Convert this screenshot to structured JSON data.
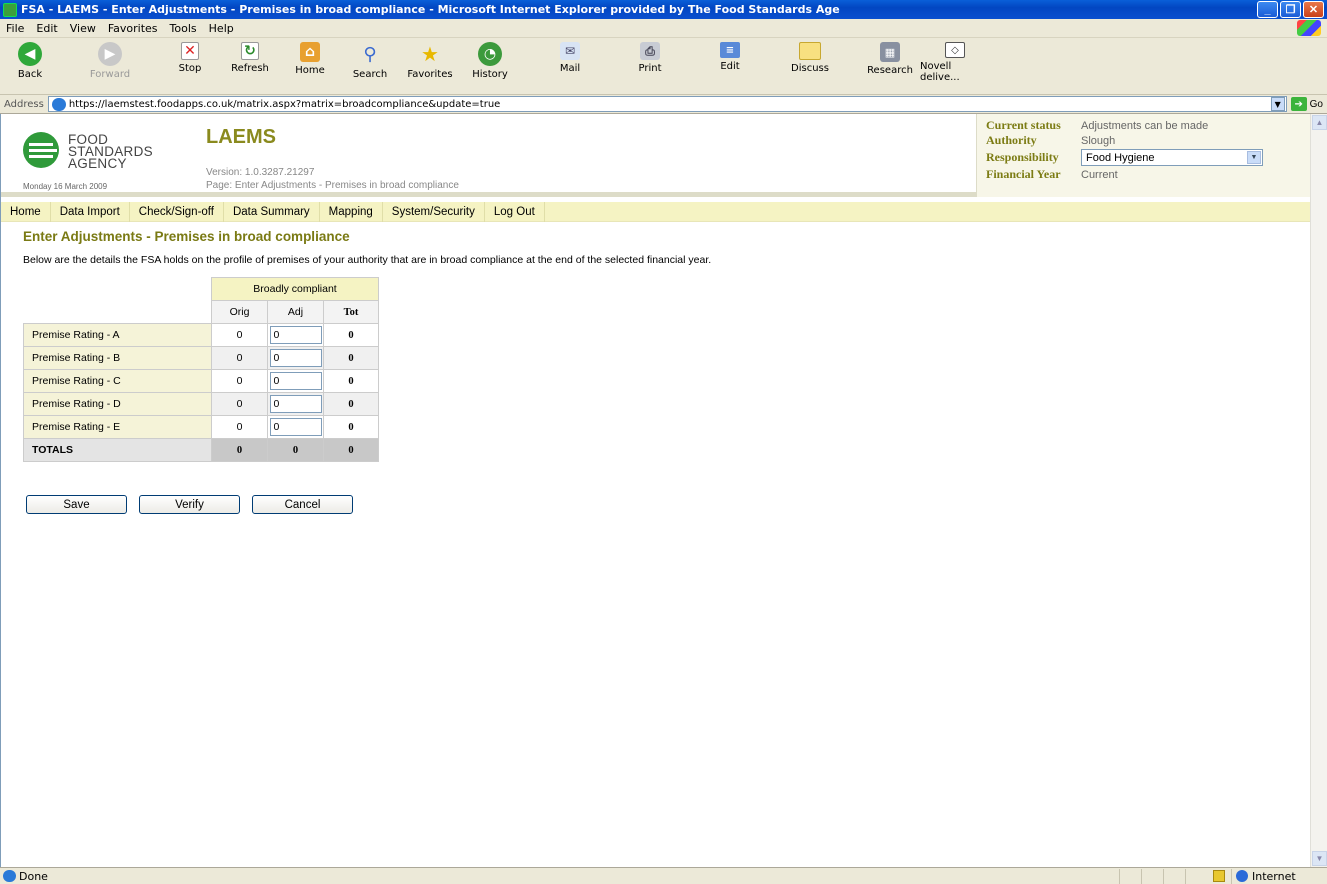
{
  "window": {
    "title": "FSA - LAEMS - Enter Adjustments - Premises in broad compliance - Microsoft Internet Explorer provided by The Food Standards Age"
  },
  "menu": [
    "File",
    "Edit",
    "View",
    "Favorites",
    "Tools",
    "Help"
  ],
  "toolbar": {
    "back": "Back",
    "forward": "Forward",
    "stop": "Stop",
    "refresh": "Refresh",
    "home": "Home",
    "search": "Search",
    "favorites": "Favorites",
    "history": "History",
    "mail": "Mail",
    "print": "Print",
    "edit": "Edit",
    "discuss": "Discuss",
    "research": "Research",
    "novell": "Novell delive..."
  },
  "address": {
    "label": "Address",
    "url": "https://laemstest.foodapps.co.uk/matrix.aspx?matrix=broadcompliance&update=true",
    "go": "Go"
  },
  "header": {
    "logo_lines": [
      "FOOD",
      "STANDARDS",
      "AGENCY"
    ],
    "date": "Monday 16 March 2009",
    "app_title": "LAEMS",
    "version": "Version: 1.0.3287.21297",
    "page": "Page: Enter Adjustments - Premises in broad compliance"
  },
  "status": {
    "current_status_label": "Current status",
    "current_status_value": "Adjustments can be made",
    "authority_label": "Authority",
    "authority_value": "Slough",
    "responsibility_label": "Responsibility",
    "responsibility_value": "Food Hygiene",
    "financial_year_label": "Financial Year",
    "financial_year_value": "Current"
  },
  "nav": [
    "Home",
    "Data Import",
    "Check/Sign-off",
    "Data Summary",
    "Mapping",
    "System/Security",
    "Log Out"
  ],
  "main": {
    "title": "Enter Adjustments - Premises in broad compliance",
    "description": "Below are the details the FSA holds on the profile of premises of your authority that are in broad compliance at the end of the selected financial year.",
    "group_header": "Broadly compliant",
    "columns": [
      "Orig",
      "Adj",
      "Tot"
    ],
    "rows": [
      {
        "label": "Premise Rating - A",
        "orig": "0",
        "adj": "0",
        "tot": "0"
      },
      {
        "label": "Premise Rating - B",
        "orig": "0",
        "adj": "0",
        "tot": "0"
      },
      {
        "label": "Premise Rating - C",
        "orig": "0",
        "adj": "0",
        "tot": "0"
      },
      {
        "label": "Premise Rating - D",
        "orig": "0",
        "adj": "0",
        "tot": "0"
      },
      {
        "label": "Premise Rating - E",
        "orig": "0",
        "adj": "0",
        "tot": "0"
      }
    ],
    "totals": {
      "label": "TOTALS",
      "orig": "0",
      "adj": "0",
      "tot": "0"
    },
    "buttons": {
      "save": "Save",
      "verify": "Verify",
      "cancel": "Cancel"
    }
  },
  "statusbar": {
    "text": "Done",
    "zone": "Internet"
  },
  "colors": {
    "accent_olive": "#7a7a14",
    "nav_bg": "#f5f3c3",
    "logo_green": "#2f9a3a"
  }
}
